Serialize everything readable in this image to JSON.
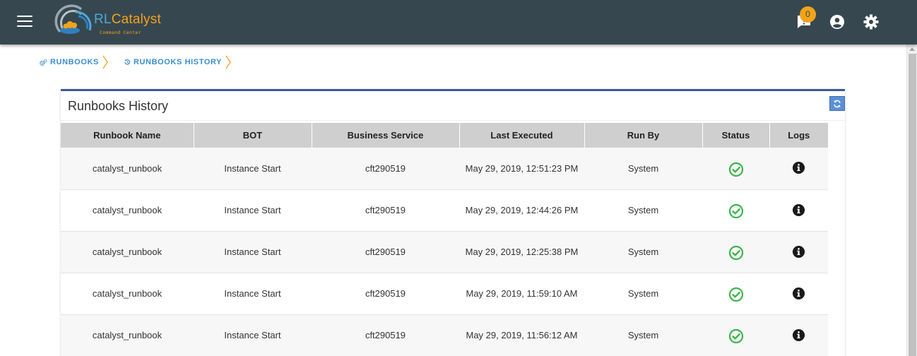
{
  "header": {
    "logo": {
      "name": "RLCatalyst",
      "prefix": "RL",
      "suffix": "Catalyst",
      "subtitle": "Command Center"
    },
    "notifications_count": "0",
    "icons": [
      "menu-icon",
      "notification-icon",
      "account-icon",
      "settings-icon"
    ]
  },
  "breadcrumb": {
    "items": [
      {
        "label": "RUNBOOKS",
        "icon": "cogs-icon"
      },
      {
        "label": "RUNBOOKS HISTORY",
        "icon": "history-icon"
      }
    ]
  },
  "card": {
    "title": "Runbooks History",
    "refresh_icon": "refresh-icon"
  },
  "table": {
    "columns": [
      "Runbook Name",
      "BOT",
      "Business Service",
      "Last Executed",
      "Run By",
      "Status",
      "Logs"
    ],
    "rows": [
      {
        "runbook_name": "catalyst_runbook",
        "bot": "Instance Start",
        "business_service": "cft290519",
        "last_executed": "May 29, 2019, 12:51:23 PM",
        "run_by": "System",
        "status": "success",
        "logs_icon": "info-icon"
      },
      {
        "runbook_name": "catalyst_runbook",
        "bot": "Instance Start",
        "business_service": "cft290519",
        "last_executed": "May 29, 2019, 12:44:26 PM",
        "run_by": "System",
        "status": "success",
        "logs_icon": "info-icon"
      },
      {
        "runbook_name": "catalyst_runbook",
        "bot": "Instance Start",
        "business_service": "cft290519",
        "last_executed": "May 29, 2019, 12:25:38 PM",
        "run_by": "System",
        "status": "success",
        "logs_icon": "info-icon"
      },
      {
        "runbook_name": "catalyst_runbook",
        "bot": "Instance Start",
        "business_service": "cft290519",
        "last_executed": "May 29, 2019, 11:59:10 AM",
        "run_by": "System",
        "status": "success",
        "logs_icon": "info-icon"
      },
      {
        "runbook_name": "catalyst_runbook",
        "bot": "Instance Start",
        "business_service": "cft290519",
        "last_executed": "May 29, 2019, 11:56:12 AM",
        "run_by": "System",
        "status": "success",
        "logs_icon": "info-icon"
      }
    ]
  },
  "colors": {
    "topbar": "#37474f",
    "accent": "#f3a31b",
    "link": "#3a8dd0",
    "card_border": "#3b5998",
    "status_success": "#3cb54a"
  }
}
